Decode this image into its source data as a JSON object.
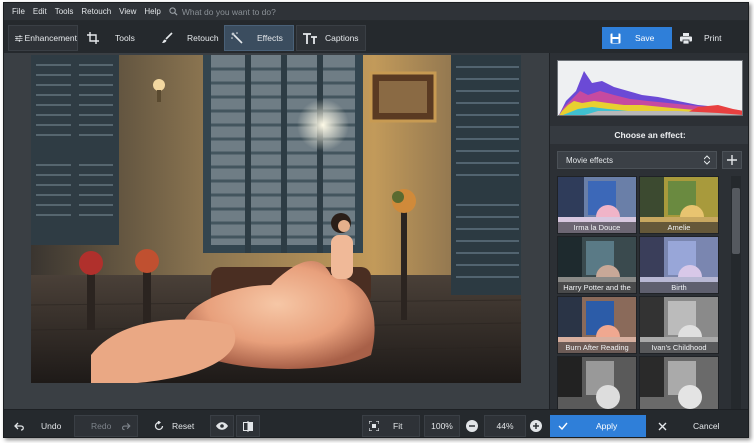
{
  "menu": {
    "items": [
      "File",
      "Edit",
      "Tools",
      "Retouch",
      "View",
      "Help"
    ],
    "search_placeholder": "What do you want to do?"
  },
  "toolbar": {
    "tabs": [
      {
        "label": "Enhancement",
        "icon": "sliders-icon"
      },
      {
        "label": "Tools",
        "icon": "crop-icon"
      },
      {
        "label": "Retouch",
        "icon": "brush-icon"
      },
      {
        "label": "Effects",
        "icon": "magic-wand-icon",
        "active": true
      },
      {
        "label": "Captions",
        "icon": "text-icon"
      }
    ],
    "save_label": "Save",
    "print_label": "Print"
  },
  "panel": {
    "title": "Choose an effect:",
    "category": "Movie effects",
    "effects": [
      {
        "label": "Irma la Douce"
      },
      {
        "label": "Amelie"
      },
      {
        "label": "Harry Potter and the"
      },
      {
        "label": "Birth"
      },
      {
        "label": "Burn After Reading"
      },
      {
        "label": "Ivan's Childhood"
      },
      {
        "label": ""
      },
      {
        "label": ""
      }
    ]
  },
  "bottom": {
    "undo_label": "Undo",
    "redo_label": "Redo",
    "reset_label": "Reset",
    "fit_label": "Fit",
    "zoom_100_label": "100%",
    "zoom_value": "44%",
    "apply_label": "Apply",
    "cancel_label": "Cancel"
  },
  "colors": {
    "accent": "#2f7fd9",
    "background": "#2b2f33",
    "toolbar": "#25292d",
    "active_tab": "#3b4d5f"
  }
}
